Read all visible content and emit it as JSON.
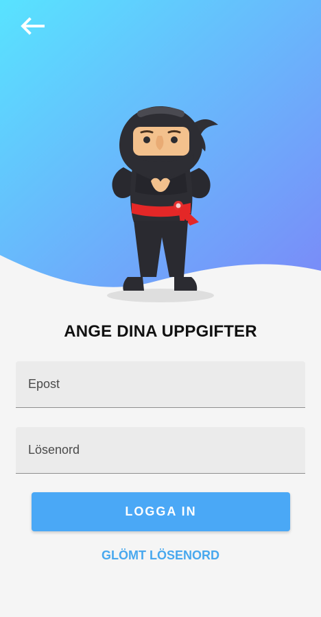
{
  "header": {
    "back_icon": "arrow-left-icon"
  },
  "hero": {
    "gradient_start": "#58e3ff",
    "gradient_end": "#7a8af8",
    "illustration": "ninja-mascot-illustration"
  },
  "form": {
    "title": "ANGE DINA UPPGIFTER",
    "email": {
      "value": "",
      "placeholder": "Epost"
    },
    "password": {
      "value": "",
      "placeholder": "Lösenord"
    },
    "login_label": "LOGGA IN",
    "forgot_password_label": "GLÖMT LÖSENORD"
  },
  "colors": {
    "background": "#f5f5f5",
    "primary_button": "#4aa8f6",
    "link": "#48a8ee"
  }
}
